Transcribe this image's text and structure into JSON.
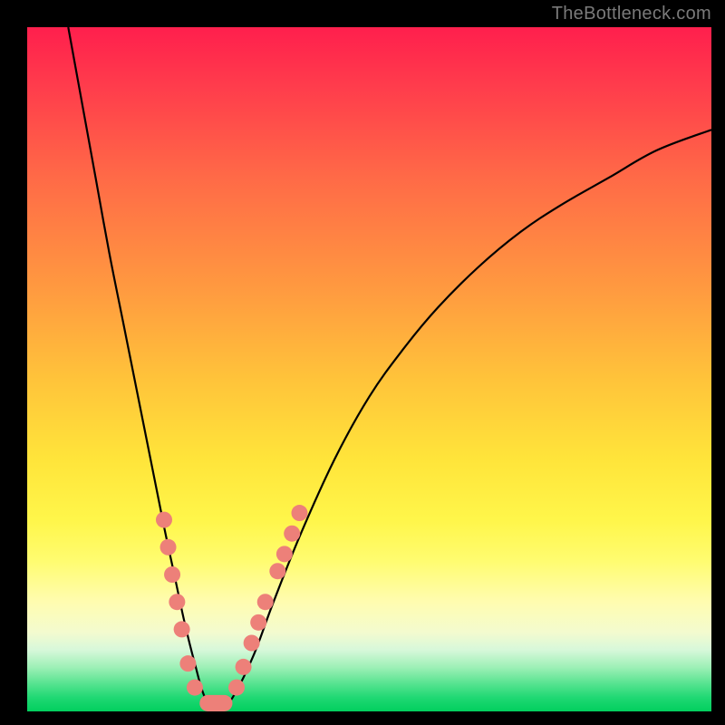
{
  "watermark": "TheBottleneck.com",
  "colors": {
    "background": "#000000",
    "gradient_top": "#ff1f4d",
    "gradient_bottom": "#02cf5e",
    "curve": "#000000",
    "beads": "#ed8079"
  },
  "chart_data": {
    "type": "line",
    "title": "",
    "xlabel": "",
    "ylabel": "",
    "xlim": [
      0,
      100
    ],
    "ylim": [
      0,
      100
    ],
    "annotations": [
      "TheBottleneck.com"
    ],
    "legend": [],
    "grid": false,
    "series": [
      {
        "name": "bottleneck_curve",
        "x": [
          6,
          8,
          10,
          12,
          14,
          16,
          18,
          20,
          21.5,
          23,
          24.5,
          26,
          28,
          30,
          33,
          36,
          40,
          45,
          50,
          55,
          60,
          66,
          72,
          78,
          85,
          92,
          100
        ],
        "y": [
          100,
          89,
          78,
          67,
          57,
          47,
          37,
          27,
          20,
          13,
          7,
          2,
          0,
          2,
          8,
          16,
          26,
          37,
          46,
          53,
          59,
          65,
          70,
          74,
          78,
          82,
          85
        ]
      }
    ],
    "markers": {
      "name": "beads",
      "points": [
        {
          "x": 20.0,
          "y": 28
        },
        {
          "x": 20.6,
          "y": 24
        },
        {
          "x": 21.2,
          "y": 20
        },
        {
          "x": 21.9,
          "y": 16
        },
        {
          "x": 22.6,
          "y": 12
        },
        {
          "x": 23.5,
          "y": 7
        },
        {
          "x": 24.5,
          "y": 3.5
        },
        {
          "x": 30.6,
          "y": 3.5
        },
        {
          "x": 31.6,
          "y": 6.5
        },
        {
          "x": 32.8,
          "y": 10
        },
        {
          "x": 33.8,
          "y": 13
        },
        {
          "x": 34.8,
          "y": 16
        },
        {
          "x": 36.6,
          "y": 20.5
        },
        {
          "x": 37.6,
          "y": 23
        },
        {
          "x": 38.7,
          "y": 26
        },
        {
          "x": 39.8,
          "y": 29
        }
      ]
    },
    "valley_bar": {
      "x_start": 25.2,
      "x_end": 30.0,
      "y": 0,
      "height": 2.4
    }
  }
}
